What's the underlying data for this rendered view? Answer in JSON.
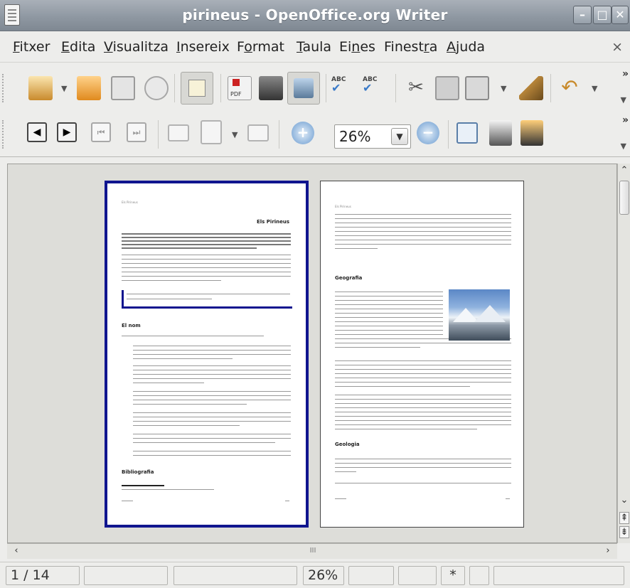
{
  "window": {
    "title": "pirineus - OpenOffice.org Writer"
  },
  "menu": {
    "items": [
      {
        "label": "Fitxer",
        "accel": "F"
      },
      {
        "label": "Edita",
        "accel": "E"
      },
      {
        "label": "Visualitza",
        "accel": "V"
      },
      {
        "label": "Insereix",
        "accel": "I"
      },
      {
        "label": "Format",
        "accel": "o"
      },
      {
        "label": "Taula",
        "accel": "T"
      },
      {
        "label": "Eines",
        "accel": "n"
      },
      {
        "label": "Finestra",
        "accel": "r"
      },
      {
        "label": "Ajuda",
        "accel": "A"
      }
    ],
    "close_glyph": "×"
  },
  "toolbar1": {
    "icons": [
      "new-document-icon",
      "open-folder-icon",
      "save-icon",
      "send-email-icon",
      "edit-mode-icon",
      "export-pdf-icon",
      "print-icon",
      "print-preview-icon",
      "spellcheck-icon",
      "autospellcheck-icon",
      "cut-icon",
      "copy-icon",
      "paste-icon",
      "format-paintbrush-icon",
      "undo-icon"
    ],
    "overflow_glyph": "»"
  },
  "toolbar2": {
    "icons": [
      "previous-page-icon",
      "next-page-icon",
      "first-page-icon",
      "last-page-icon",
      "two-pages-icon",
      "multi-page-icon",
      "book-preview-icon",
      "zoom-in-icon",
      "zoom-out-icon",
      "fullscreen-icon",
      "print-options-icon",
      "print-page-view-icon",
      "close-preview-icon"
    ],
    "zoom_value": "26%",
    "overflow_glyph": "»"
  },
  "document": {
    "page1": {
      "header_text": "Els Pirineus",
      "title": "Els Pirineus",
      "section1": "El nom",
      "footer_title": "Bibliografia"
    },
    "page2": {
      "header_text": "Els Pirineus",
      "section1": "Geografia",
      "section2": "Geologia"
    }
  },
  "hscroll": {
    "center_glyph": "III"
  },
  "statusbar": {
    "page": "1 / 14",
    "zoom": "26%",
    "modified": "*"
  },
  "colors": {
    "selected_page_border": "#10158f",
    "titlebar": "#8f98a2"
  }
}
